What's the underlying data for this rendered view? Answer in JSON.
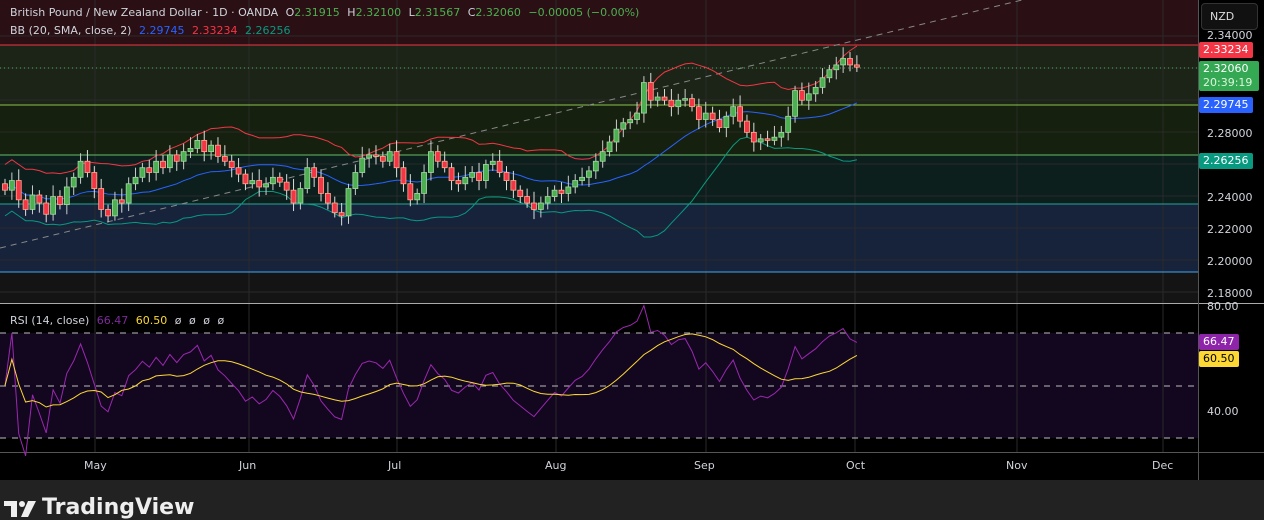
{
  "header": {
    "symbol": "British Pound / New Zealand Dollar · 1D · OANDA",
    "o_label": "O",
    "o": "2.31915",
    "h_label": "H",
    "h": "2.32100",
    "l_label": "L",
    "l": "2.31567",
    "c_label": "C",
    "c": "2.32060",
    "change": "−0.00005 (−0.00%)"
  },
  "bb": {
    "label": "BB (20, SMA, close, 2)",
    "basis": "2.29745",
    "upper": "2.33234",
    "lower": "2.26256"
  },
  "rsi": {
    "label": "RSI (14, close)",
    "value": "66.47",
    "ma": "60.50",
    "extras": [
      "ø",
      "ø",
      "ø",
      "ø"
    ]
  },
  "price_axis": {
    "currency": "NZD",
    "ticks": [
      "2.34000",
      "2.28000",
      "2.24000",
      "2.22000",
      "2.20000",
      "2.18000"
    ],
    "current": "2.32060",
    "countdown": "20:39:19",
    "upper_tag": "2.33234",
    "basis_tag": "2.29745",
    "lower_tag": "2.26256"
  },
  "rsi_axis": {
    "ticks": [
      "80.00",
      "40.00"
    ],
    "rsi_tag": "66.47",
    "ma_tag": "60.50"
  },
  "time_axis": [
    "May",
    "Jun",
    "Jul",
    "Aug",
    "Sep",
    "Oct",
    "Nov",
    "Dec"
  ],
  "brand": "TradingView",
  "colors": {
    "up": "#4caf50",
    "down": "#f23645",
    "basis": "#2962ff",
    "upper": "#f23645",
    "lower": "#089981",
    "rsi": "#7e57c2",
    "rsi_ma": "#fdd835"
  },
  "chart_data": {
    "type": "candlestick",
    "closes": [
      2.244,
      2.25,
      2.238,
      2.232,
      2.241,
      2.236,
      2.229,
      2.24,
      2.235,
      2.246,
      2.252,
      2.262,
      2.255,
      2.245,
      2.232,
      2.228,
      2.238,
      2.236,
      2.248,
      2.252,
      2.258,
      2.255,
      2.262,
      2.258,
      2.266,
      2.262,
      2.268,
      2.27,
      2.275,
      2.268,
      2.272,
      2.265,
      2.262,
      2.258,
      2.254,
      2.248,
      2.25,
      2.246,
      2.248,
      2.252,
      2.249,
      2.244,
      2.236,
      2.245,
      2.258,
      2.252,
      2.242,
      2.236,
      2.23,
      2.228,
      2.245,
      2.255,
      2.264,
      2.266,
      2.265,
      2.262,
      2.268,
      2.258,
      2.248,
      2.238,
      2.242,
      2.255,
      2.268,
      2.262,
      2.258,
      2.25,
      2.248,
      2.252,
      2.255,
      2.25,
      2.26,
      2.262,
      2.255,
      2.25,
      2.244,
      2.24,
      2.236,
      2.232,
      2.236,
      2.24,
      2.244,
      2.242,
      2.246,
      2.25,
      2.252,
      2.256,
      2.262,
      2.268,
      2.274,
      2.282,
      2.286,
      2.288,
      2.292,
      2.311,
      2.3,
      2.302,
      2.3,
      2.296,
      2.3,
      2.301,
      2.296,
      2.288,
      2.292,
      2.288,
      2.283,
      2.29,
      2.296,
      2.287,
      2.28,
      2.274,
      2.276,
      2.275,
      2.277,
      2.28,
      2.29,
      2.306,
      2.3,
      2.304,
      2.308,
      2.314,
      2.319,
      2.322,
      2.326,
      2.322,
      2.3206
    ],
    "ylim": [
      2.175,
      2.36
    ],
    "rsi_ylim": [
      20,
      85
    ]
  }
}
